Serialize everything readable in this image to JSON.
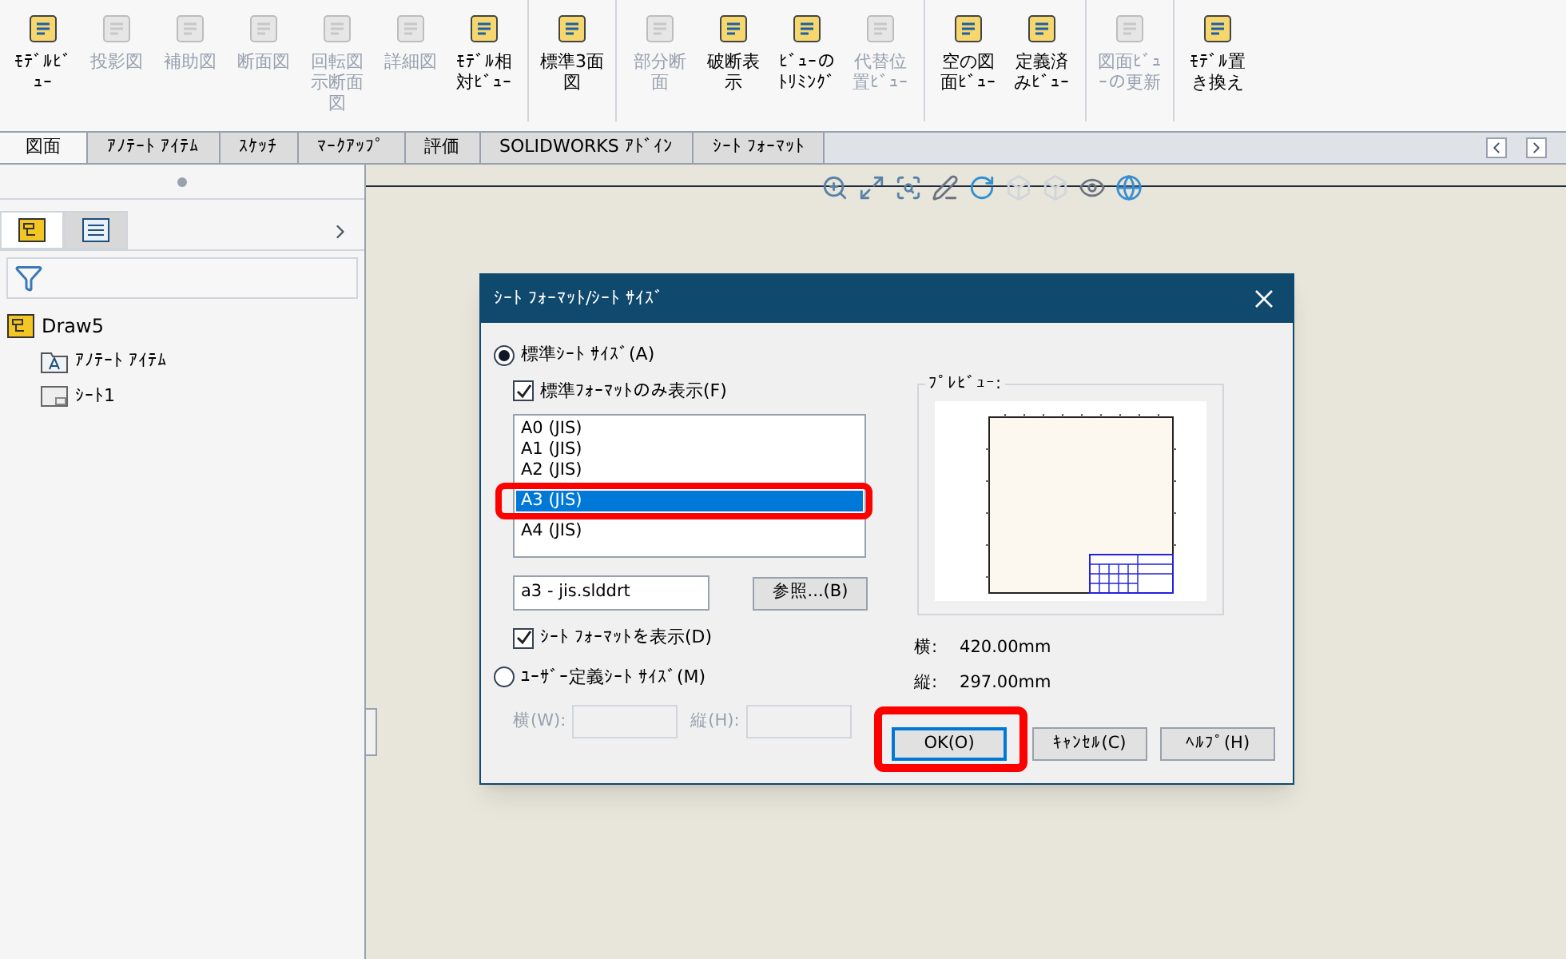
{
  "toolbar": {
    "groups": [
      [
        {
          "label": "ﾓﾃﾞﾙﾋﾞｭｰ",
          "disabled": false
        },
        {
          "label": "投影図",
          "disabled": true
        },
        {
          "label": "補助図",
          "disabled": true
        },
        {
          "label": "断面図",
          "disabled": true
        },
        {
          "label": "回転図示断面図",
          "disabled": true
        },
        {
          "label": "詳細図",
          "disabled": true
        },
        {
          "label": "ﾓﾃﾞﾙ相対ﾋﾞｭｰ",
          "disabled": false
        }
      ],
      [
        {
          "label": "標準3面図",
          "disabled": false
        }
      ],
      [
        {
          "label": "部分断面",
          "disabled": true
        },
        {
          "label": "破断表示",
          "disabled": false
        },
        {
          "label": "ﾋﾞｭｰのﾄﾘﾐﾝｸﾞ",
          "disabled": false
        },
        {
          "label": "代替位置ﾋﾞｭｰ",
          "disabled": true
        }
      ],
      [
        {
          "label": "空の図面ﾋﾞｭｰ",
          "disabled": false
        },
        {
          "label": "定義済みﾋﾞｭｰ",
          "disabled": false
        }
      ],
      [
        {
          "label": "図面ﾋﾞｭｰの更新",
          "disabled": true
        }
      ],
      [
        {
          "label": "ﾓﾃﾞﾙ置き換え",
          "disabled": false
        }
      ]
    ]
  },
  "tabs": [
    {
      "label": "図面",
      "selected": true
    },
    {
      "label": "ｱﾉﾃｰﾄ ｱｲﾃﾑ",
      "selected": false
    },
    {
      "label": "ｽｹｯﾁ",
      "selected": false
    },
    {
      "label": "ﾏｰｸｱｯﾌﾟ",
      "selected": false
    },
    {
      "label": "評価",
      "selected": false
    },
    {
      "label": "SOLIDWORKS ｱﾄﾞｲﾝ",
      "selected": false
    },
    {
      "label": "ｼｰﾄ ﾌｫｰﾏｯﾄ",
      "selected": false
    }
  ],
  "feature_tree": {
    "root": "Draw5",
    "children": [
      {
        "label": "ｱﾉﾃｰﾄ ｱｲﾃﾑ",
        "kind": "annotation"
      },
      {
        "label": "ｼｰﾄ1",
        "kind": "sheet"
      }
    ]
  },
  "dialog": {
    "title": "ｼｰﾄ ﾌｫｰﾏｯﾄ/ｼｰﾄ ｻｲｽﾞ",
    "standard_size": {
      "label": "標準ｼｰﾄ ｻｲｽﾞ(A)",
      "selected": true
    },
    "standard_only": {
      "label": "標準ﾌｫｰﾏｯﾄのみ表示(F)",
      "checked": true
    },
    "sizes": [
      {
        "label": "A0 (JIS)",
        "selected": false
      },
      {
        "label": "A1 (JIS)",
        "selected": false
      },
      {
        "label": "A2 (JIS)",
        "selected": false
      },
      {
        "label": "A3 (JIS)",
        "selected": true
      },
      {
        "label": "A4 (JIS)",
        "selected": false
      }
    ],
    "format_file": "a3 - jis.slddrt",
    "browse_button": "参照...(B)",
    "show_format": {
      "label": "ｼｰﾄ ﾌｫｰﾏｯﾄを表示(D)",
      "checked": true
    },
    "custom_size": {
      "label": "ﾕｰｻﾞｰ定義ｼｰﾄ ｻｲｽﾞ(M)",
      "selected": false
    },
    "width_label": "横(W):",
    "height_label": "縦(H):",
    "preview_label": "ﾌﾟﾚﾋﾞｭｰ:",
    "dims": [
      {
        "label": "横:",
        "value": "420.00mm"
      },
      {
        "label": "縦:",
        "value": "297.00mm"
      }
    ],
    "buttons": [
      "OK(O)",
      "ｷｬﾝｾﾙ(C)",
      "ﾍﾙﾌﾟ(H)"
    ]
  }
}
